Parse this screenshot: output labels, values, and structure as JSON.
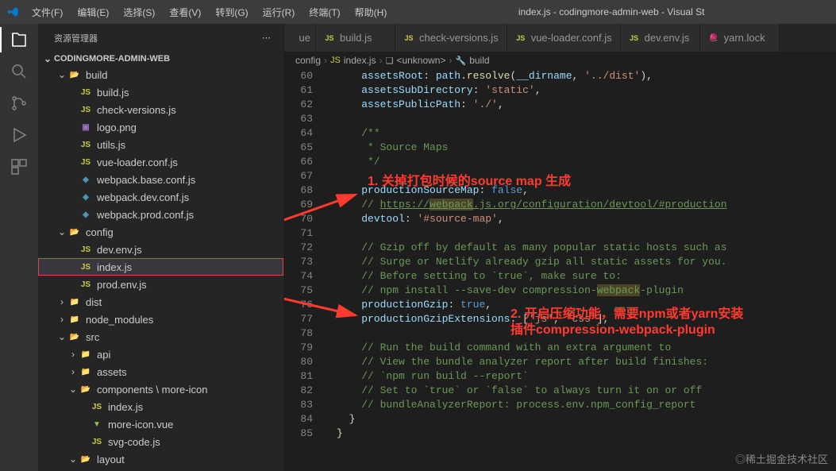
{
  "titlebar": {
    "menus": [
      "文件(F)",
      "编辑(E)",
      "选择(S)",
      "查看(V)",
      "转到(G)",
      "运行(R)",
      "终端(T)",
      "帮助(H)"
    ],
    "title": "index.js - codingmore-admin-web - Visual St"
  },
  "sidebar": {
    "header": "资源管理器",
    "section": "CODINGMORE-ADMIN-WEB",
    "tree": [
      {
        "type": "folder-open",
        "label": "build",
        "indent": 1,
        "expanded": true
      },
      {
        "type": "js",
        "label": "build.js",
        "indent": 2
      },
      {
        "type": "js",
        "label": "check-versions.js",
        "indent": 2
      },
      {
        "type": "image",
        "label": "logo.png",
        "indent": 2
      },
      {
        "type": "js",
        "label": "utils.js",
        "indent": 2
      },
      {
        "type": "js",
        "label": "vue-loader.conf.js",
        "indent": 2
      },
      {
        "type": "webpack",
        "label": "webpack.base.conf.js",
        "indent": 2
      },
      {
        "type": "webpack",
        "label": "webpack.dev.conf.js",
        "indent": 2
      },
      {
        "type": "webpack",
        "label": "webpack.prod.conf.js",
        "indent": 2
      },
      {
        "type": "folder-open",
        "label": "config",
        "indent": 1,
        "expanded": true
      },
      {
        "type": "js",
        "label": "dev.env.js",
        "indent": 2
      },
      {
        "type": "js",
        "label": "index.js",
        "indent": 2,
        "selected": true
      },
      {
        "type": "js",
        "label": "prod.env.js",
        "indent": 2
      },
      {
        "type": "folder",
        "label": "dist",
        "indent": 1,
        "collapsed": true
      },
      {
        "type": "folder-green",
        "label": "node_modules",
        "indent": 1,
        "collapsed": true
      },
      {
        "type": "folder-open",
        "label": "src",
        "indent": 1,
        "expanded": true
      },
      {
        "type": "folder",
        "label": "api",
        "indent": 2,
        "collapsed": true
      },
      {
        "type": "folder",
        "label": "assets",
        "indent": 2,
        "collapsed": true
      },
      {
        "type": "folder-open",
        "label": "components \\ more-icon",
        "indent": 2,
        "expanded": true
      },
      {
        "type": "js",
        "label": "index.js",
        "indent": 3
      },
      {
        "type": "vue",
        "label": "more-icon.vue",
        "indent": 3
      },
      {
        "type": "js",
        "label": "svg-code.js",
        "indent": 3
      },
      {
        "type": "folder-open",
        "label": "layout",
        "indent": 2,
        "expanded": true
      }
    ]
  },
  "tabs": {
    "partial": "ue",
    "items": [
      {
        "icon": "js",
        "label": "build.js"
      },
      {
        "icon": "js",
        "label": "check-versions.js"
      },
      {
        "icon": "js",
        "label": "vue-loader.conf.js"
      },
      {
        "icon": "js",
        "label": "dev.env.js"
      },
      {
        "icon": "yarn",
        "label": "yarn.lock"
      }
    ]
  },
  "breadcrumbs": [
    "config",
    "index.js",
    "<unknown>",
    "build"
  ],
  "lines": {
    "start": 60,
    "end": 85
  },
  "code": {
    "l60": {
      "key": "assetsRoot",
      "rest": ": path.resolve(__dirname, '../dist'),"
    },
    "l61": {
      "key": "assetsSubDirectory",
      "str": "'static'"
    },
    "l62": {
      "key": "assetsPublicPath",
      "str": "'./'"
    },
    "l64": "/**",
    "l65": " * Source Maps",
    "l66": " */",
    "l68": {
      "key": "productionSourceMap",
      "bool": "false"
    },
    "l69": "// https://webpack.js.org/configuration/devtool/#production",
    "l70": {
      "key": "devtool",
      "str": "'#source-map'"
    },
    "l72": "// Gzip off by default as many popular static hosts such as",
    "l73": "// Surge or Netlify already gzip all static assets for you.",
    "l74": "// Before setting to `true`, make sure to:",
    "l75": "// npm install --save-dev compression-webpack-plugin",
    "l76": {
      "key": "productionGzip",
      "bool": "true"
    },
    "l77": {
      "key": "productionGzipExtensions",
      "rest": ": ['js', 'css'],"
    },
    "l79": "// Run the build command with an extra argument to",
    "l80": "// View the bundle analyzer report after build finishes:",
    "l81": "// `npm run build --report`",
    "l82": "// Set to `true` or `false` to always turn it on or off",
    "l83": "// bundleAnalyzerReport: process.env.npm_config_report",
    "l84": "}"
  },
  "annotations": {
    "a1_line1": "1. 关掉打包时候的source map 生成",
    "a2_line1": "2. 开启压缩功能，需要npm或者yarn安装",
    "a2_line2": "插件compression-webpack-plugin"
  },
  "watermark": "◎稀土掘金技术社区"
}
